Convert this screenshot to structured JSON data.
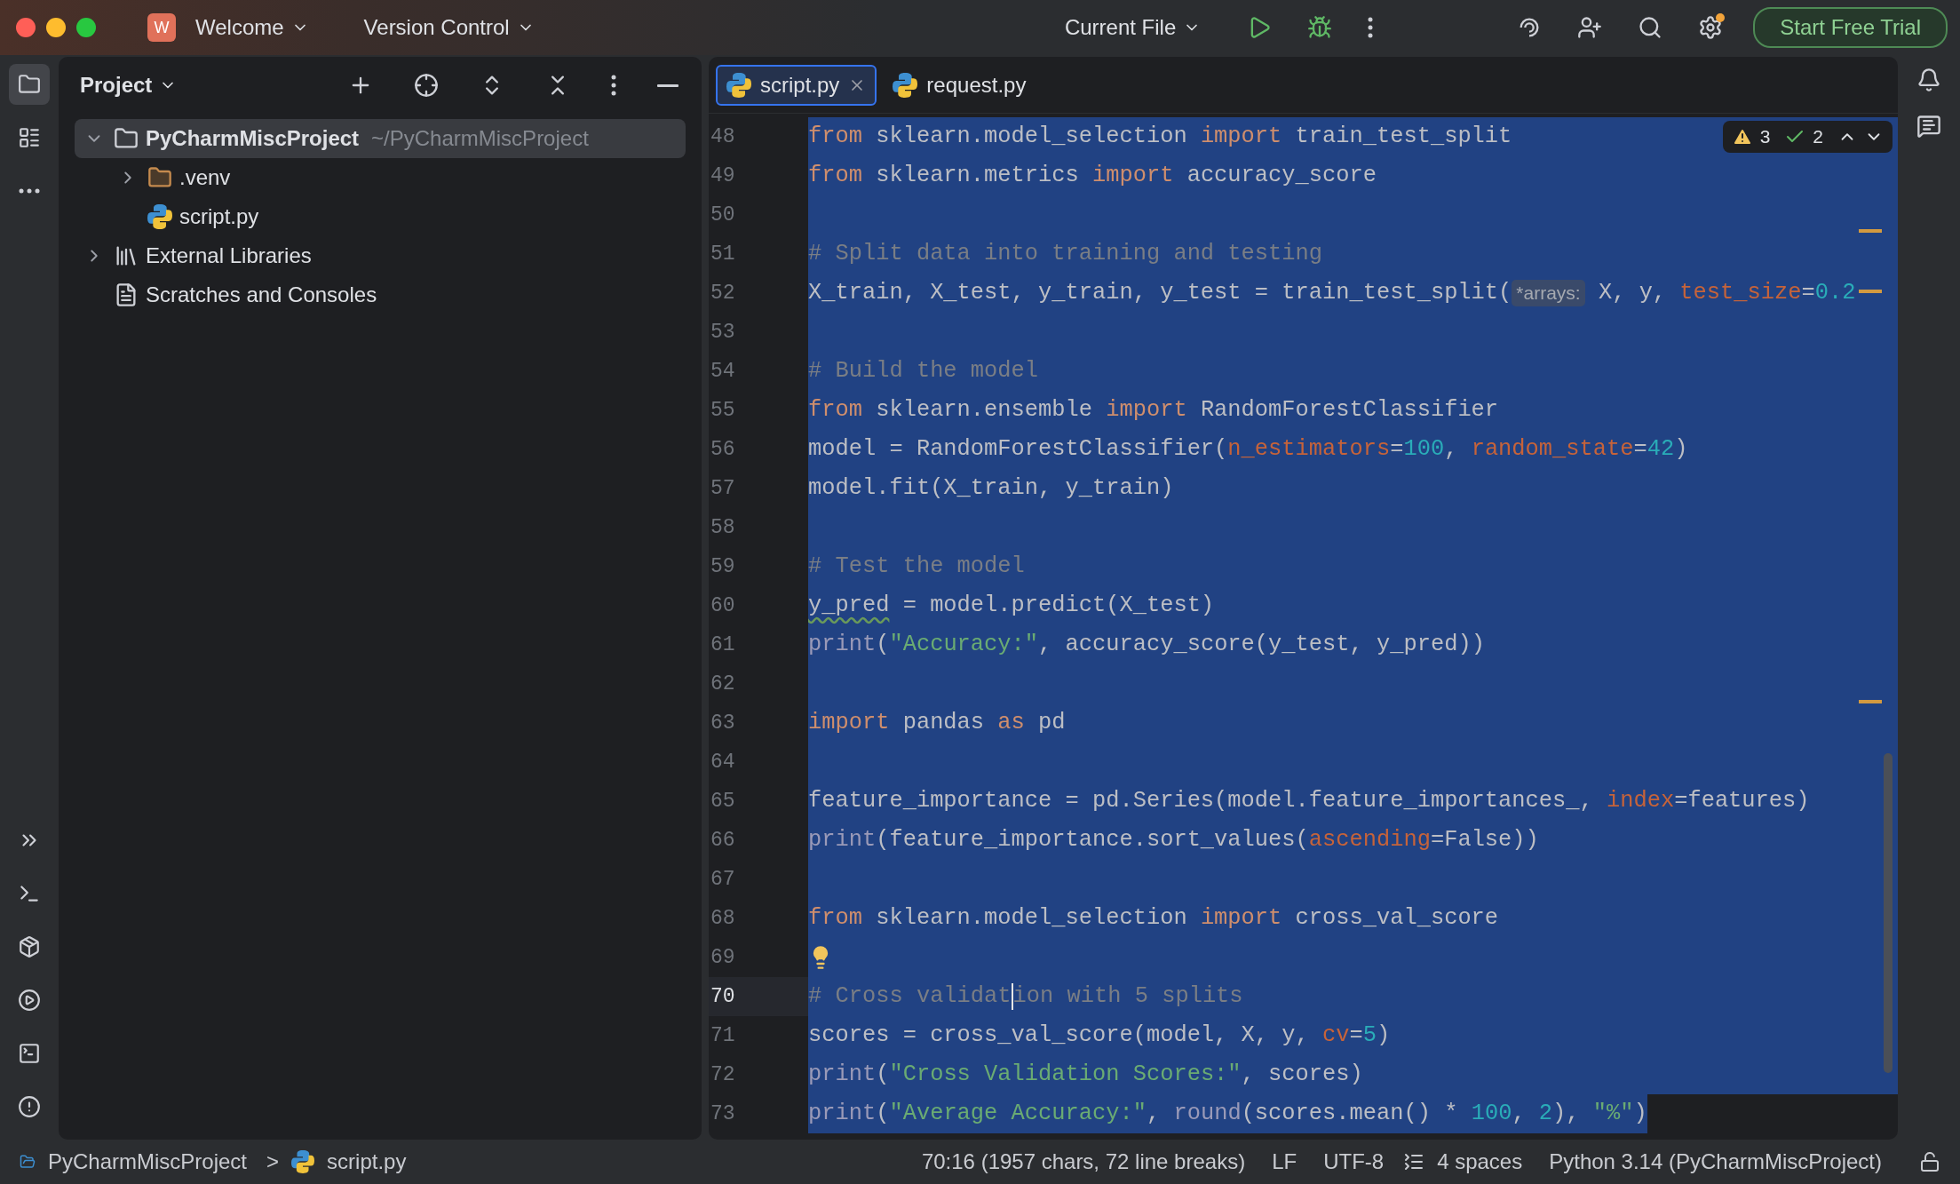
{
  "title_bar": {
    "project_badge": "W",
    "project": "Welcome",
    "vcs": "Version Control",
    "run_config": "Current File",
    "trial_button": "Start Free Trial",
    "settings_update": true
  },
  "tool_strip": {
    "items": [
      {
        "kind": "folder",
        "selected": true
      },
      {
        "kind": "structure",
        "selected": false
      },
      {
        "kind": "more",
        "selected": false
      }
    ],
    "bottom": [
      {
        "kind": "chevrons"
      },
      {
        "kind": "console"
      },
      {
        "kind": "packages"
      },
      {
        "kind": "services"
      },
      {
        "kind": "terminal"
      },
      {
        "kind": "problems"
      }
    ]
  },
  "project_panel": {
    "title": "Project",
    "tree": [
      {
        "label": "PyCharmMiscProject",
        "hint": "~/PyCharmMiscProject",
        "kind": "folder",
        "expanded": true,
        "selected": true,
        "children": [
          {
            "label": ".venv",
            "kind": "venv",
            "expanded": false,
            "selected": false
          },
          {
            "label": "script.py",
            "kind": "python",
            "selected": false
          }
        ]
      },
      {
        "label": "External Libraries",
        "kind": "library",
        "expanded": false,
        "selected": false
      },
      {
        "label": "Scratches and Consoles",
        "kind": "scratches",
        "selected": false
      }
    ]
  },
  "editor": {
    "tabs": [
      {
        "label": "script.py",
        "selected": true
      },
      {
        "label": "request.py",
        "selected": false
      }
    ],
    "inspections": {
      "warnings": "3",
      "weak_warnings": "2"
    },
    "lines": [
      {
        "number": "48",
        "current": false,
        "kind": "full",
        "tokens": [
          {
            "kind": "kw",
            "t": "from"
          },
          {
            "kind": "id",
            "t": " sklearn.model_selection "
          },
          {
            "kind": "kw",
            "t": "import"
          },
          {
            "kind": "id",
            "t": " train_test_split"
          }
        ]
      },
      {
        "number": "49",
        "current": false,
        "kind": "full",
        "tokens": [
          {
            "kind": "kw",
            "t": "from"
          },
          {
            "kind": "id",
            "t": " sklearn.metrics "
          },
          {
            "kind": "kw",
            "t": "import"
          },
          {
            "kind": "id",
            "t": " accuracy_score"
          }
        ]
      },
      {
        "number": "50",
        "current": false,
        "kind": "full"
      },
      {
        "number": "51",
        "current": false,
        "kind": "full",
        "tokens": [
          {
            "kind": "cm",
            "t": "# Split data into training and testing"
          }
        ]
      },
      {
        "number": "52",
        "current": false,
        "kind": "full",
        "tokens": [
          {
            "kind": "id",
            "t": "X_train, X_test, y_train, y_test = train_test_split("
          },
          {
            "kind": "hint",
            "t": "*arrays:"
          },
          {
            "kind": "id",
            "t": " X, y, "
          },
          {
            "kind": "par",
            "t": "test_size"
          },
          {
            "kind": "id",
            "t": "="
          },
          {
            "kind": "num",
            "t": "0.2"
          }
        ]
      },
      {
        "number": "53",
        "current": false,
        "kind": "full"
      },
      {
        "number": "54",
        "current": false,
        "kind": "full",
        "tokens": [
          {
            "kind": "cm",
            "t": "# Build the model"
          }
        ]
      },
      {
        "number": "55",
        "current": false,
        "kind": "full",
        "tokens": [
          {
            "kind": "kw",
            "t": "from"
          },
          {
            "kind": "id",
            "t": " sklearn.ensemble "
          },
          {
            "kind": "kw",
            "t": "import"
          },
          {
            "kind": "id",
            "t": " RandomForestClassifier"
          }
        ]
      },
      {
        "number": "56",
        "current": false,
        "kind": "full",
        "tokens": [
          {
            "kind": "id",
            "t": "model = RandomForestClassifier("
          },
          {
            "kind": "par",
            "t": "n_estimators"
          },
          {
            "kind": "id",
            "t": "="
          },
          {
            "kind": "num",
            "t": "100"
          },
          {
            "kind": "id",
            "t": ", "
          },
          {
            "kind": "par",
            "t": "random_state"
          },
          {
            "kind": "id",
            "t": "="
          },
          {
            "kind": "num",
            "t": "42"
          },
          {
            "kind": "id",
            "t": ")"
          }
        ]
      },
      {
        "number": "57",
        "current": false,
        "kind": "full",
        "tokens": [
          {
            "kind": "id",
            "t": "model.fit(X_train, y_train)"
          }
        ]
      },
      {
        "number": "58",
        "current": false,
        "kind": "full"
      },
      {
        "number": "59",
        "current": false,
        "kind": "full",
        "tokens": [
          {
            "kind": "cm",
            "t": "# Test the model"
          }
        ]
      },
      {
        "number": "60",
        "current": false,
        "kind": "full",
        "tokens": [
          {
            "kind": "warn",
            "t": "y_pred"
          },
          {
            "kind": "id",
            "t": " = model.predict(X_test)"
          }
        ]
      },
      {
        "number": "61",
        "current": false,
        "kind": "full",
        "tokens": [
          {
            "kind": "bi",
            "t": "print"
          },
          {
            "kind": "id",
            "t": "("
          },
          {
            "kind": "str",
            "t": "\"Accuracy:\""
          },
          {
            "kind": "id",
            "t": ", accuracy_score(y_test, y_pred))"
          }
        ]
      },
      {
        "number": "62",
        "current": false,
        "kind": "full"
      },
      {
        "number": "63",
        "current": false,
        "kind": "full",
        "tokens": [
          {
            "kind": "kw",
            "t": "import"
          },
          {
            "kind": "id",
            "t": " pandas "
          },
          {
            "kind": "kw",
            "t": "as"
          },
          {
            "kind": "id",
            "t": " pd"
          }
        ]
      },
      {
        "number": "64",
        "current": false,
        "kind": "full"
      },
      {
        "number": "65",
        "current": false,
        "kind": "full",
        "tokens": [
          {
            "kind": "id",
            "t": "feature_importance = pd.Series(model.feature_importances_, "
          },
          {
            "kind": "par",
            "t": "index"
          },
          {
            "kind": "id",
            "t": "=features)"
          }
        ]
      },
      {
        "number": "66",
        "current": false,
        "kind": "full",
        "tokens": [
          {
            "kind": "bi",
            "t": "print"
          },
          {
            "kind": "id",
            "t": "(feature_importance.sort_values("
          },
          {
            "kind": "par",
            "t": "ascending"
          },
          {
            "kind": "id",
            "t": "=False))"
          }
        ]
      },
      {
        "number": "67",
        "current": false,
        "kind": "full"
      },
      {
        "number": "68",
        "current": false,
        "kind": "full",
        "tokens": [
          {
            "kind": "kw",
            "t": "from"
          },
          {
            "kind": "id",
            "t": " sklearn.model_selection "
          },
          {
            "kind": "kw",
            "t": "import"
          },
          {
            "kind": "id",
            "t": " cross_val_score"
          }
        ]
      },
      {
        "number": "69",
        "current": false,
        "kind": "full",
        "tokens": [
          {
            "kind": "bulb"
          }
        ]
      },
      {
        "number": "70",
        "current": true,
        "kind": "full",
        "tokens": [
          {
            "kind": "cm",
            "t": "# Cross validat"
          },
          {
            "kind": "caret"
          },
          {
            "kind": "cm",
            "t": "ion with 5 splits"
          }
        ]
      },
      {
        "number": "71",
        "current": false,
        "kind": "full",
        "tokens": [
          {
            "kind": "id",
            "t": "scores = cross_val_score(model, X, y, "
          },
          {
            "kind": "par",
            "t": "cv"
          },
          {
            "kind": "id",
            "t": "="
          },
          {
            "kind": "num",
            "t": "5"
          },
          {
            "kind": "id",
            "t": ")"
          }
        ]
      },
      {
        "number": "72",
        "current": false,
        "kind": "full",
        "tokens": [
          {
            "kind": "bi",
            "t": "print"
          },
          {
            "kind": "id",
            "t": "("
          },
          {
            "kind": "str",
            "t": "\"Cross Validation Scores:\""
          },
          {
            "kind": "id",
            "t": ", scores)"
          }
        ]
      },
      {
        "number": "73",
        "current": false,
        "kind": "partial",
        "tokens": [
          {
            "kind": "bi",
            "t": "print"
          },
          {
            "kind": "id",
            "t": "("
          },
          {
            "kind": "str",
            "t": "\"Average Accuracy:\""
          },
          {
            "kind": "id",
            "t": ", "
          },
          {
            "kind": "bi",
            "t": "round"
          },
          {
            "kind": "id",
            "t": "(scores.mean() * "
          },
          {
            "kind": "num",
            "t": "100"
          },
          {
            "kind": "id",
            "t": ", "
          },
          {
            "kind": "num",
            "t": "2"
          },
          {
            "kind": "id",
            "t": "), "
          },
          {
            "kind": "str",
            "t": "\"%\""
          },
          {
            "kind": "id",
            "t": ")"
          }
        ]
      }
    ]
  },
  "status_bar": {
    "breadcrumbs": [
      {
        "label": "PyCharmMiscProject",
        "kind": "module"
      },
      {
        "label": "script.py",
        "kind": "python"
      }
    ],
    "separator": ">",
    "position": "70:16 (1957 chars, 72 line breaks)",
    "line_ending": "LF",
    "encoding": "UTF-8",
    "indent": "4 spaces",
    "interpreter": "Python 3.14 (PyCharmMiscProject)"
  }
}
